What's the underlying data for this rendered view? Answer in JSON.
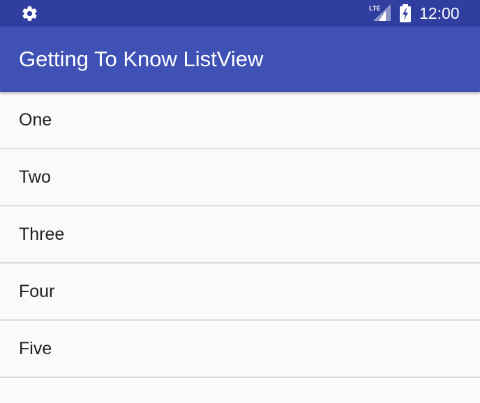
{
  "status_bar": {
    "time": "12:00",
    "network_label": "LTE",
    "icons": [
      "gear-icon",
      "lte-signal-icon",
      "battery-charging-icon"
    ]
  },
  "app_bar": {
    "title": "Getting To Know ListView"
  },
  "list": {
    "items": [
      {
        "label": "One"
      },
      {
        "label": "Two"
      },
      {
        "label": "Three"
      },
      {
        "label": "Four"
      },
      {
        "label": "Five"
      }
    ]
  },
  "colors": {
    "status_bar": "#303f9f",
    "app_bar": "#3f51b5",
    "background": "#fafafa",
    "divider": "#dcdcdc",
    "text_primary": "#212121"
  }
}
